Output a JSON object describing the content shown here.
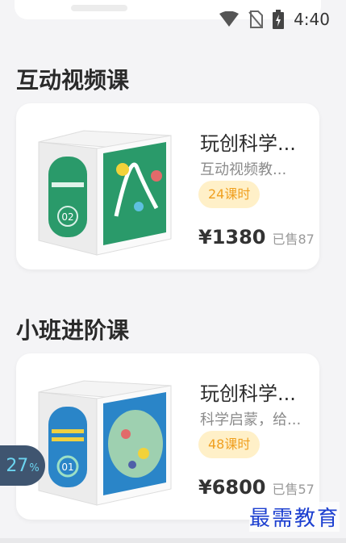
{
  "status_bar": {
    "time": "4:40"
  },
  "sections": [
    {
      "title": "互动视频课",
      "card": {
        "name": "玩创科学...",
        "description": "互动视频教...",
        "hours": "24课时",
        "price": "¥1380",
        "sold": "已售87",
        "box_color": "#2a9a6a",
        "box_label": "02"
      }
    },
    {
      "title": "小班进阶课",
      "card": {
        "name": "玩创科学...",
        "description": "科学启蒙，给...",
        "hours": "48课时",
        "price": "¥6800",
        "sold": "已售57",
        "box_color": "#2a85c8",
        "box_label": "01"
      }
    }
  ],
  "progress_bubble": {
    "value": "27",
    "unit": "%"
  },
  "watermark": "最需教育"
}
